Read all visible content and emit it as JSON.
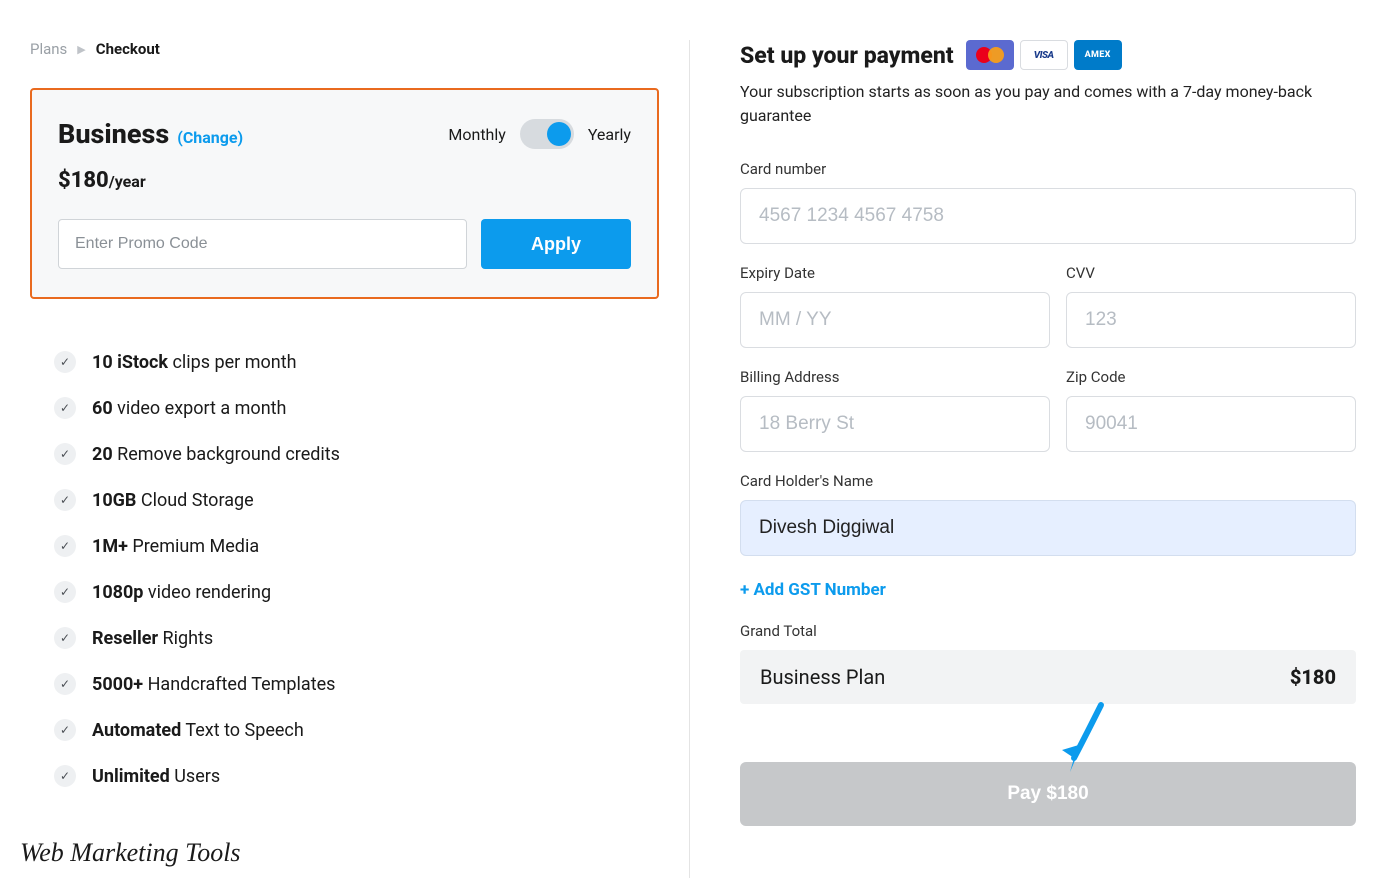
{
  "breadcrumb": {
    "plans": "Plans",
    "current": "Checkout"
  },
  "plan": {
    "name": "Business",
    "change": "(Change)",
    "monthly_label": "Monthly",
    "yearly_label": "Yearly",
    "price": "$180",
    "per": "/year",
    "promo_placeholder": "Enter Promo Code",
    "apply_label": "Apply"
  },
  "features": [
    {
      "bold": "10 iStock",
      "rest": " clips per month"
    },
    {
      "bold": "60",
      "rest": " video export a month"
    },
    {
      "bold": "20",
      "rest": " Remove background credits"
    },
    {
      "bold": "10GB",
      "rest": " Cloud Storage"
    },
    {
      "bold": "1M+",
      "rest": " Premium Media"
    },
    {
      "bold": "1080p",
      "rest": " video rendering"
    },
    {
      "bold": "Reseller",
      "rest": " Rights"
    },
    {
      "bold": "5000+",
      "rest": " Handcrafted Templates"
    },
    {
      "bold": "Automated",
      "rest": " Text to Speech"
    },
    {
      "bold": "Unlimited",
      "rest": " Users"
    }
  ],
  "watermark": "Web Marketing Tools",
  "payment": {
    "title": "Set up your payment",
    "subtitle": "Your subscription starts as soon as you pay and comes with a 7-day money-back guarantee",
    "card_number_label": "Card number",
    "card_number_placeholder": "4567 1234 4567 4758",
    "expiry_label": "Expiry Date",
    "expiry_placeholder": "MM / YY",
    "cvv_label": "CVV",
    "cvv_placeholder": "123",
    "billing_label": "Billing Address",
    "billing_placeholder": "18 Berry St",
    "zip_label": "Zip Code",
    "zip_placeholder": "90041",
    "holder_label": "Card Holder's Name",
    "holder_value": "Divesh Diggiwal",
    "gst_link": "+ Add GST Number",
    "grand_label": "Grand Total",
    "plan_line": "Business Plan",
    "plan_amount": "$180",
    "pay_button": "Pay $180",
    "visa": "VISA",
    "amex": "AMEX"
  }
}
